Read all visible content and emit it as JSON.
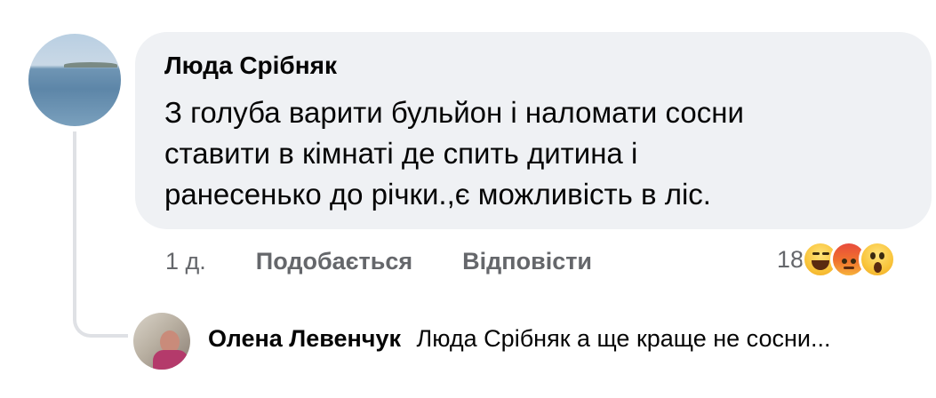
{
  "comment": {
    "author": "Люда Срібняк",
    "text": "З голуба варити бульйон і  наломати сосни\nставити в кімнаті де спить дитина і\nранесенько до річки.,є можливість в ліс.",
    "time": "1 д.",
    "like_label": "Подобається",
    "reply_label": "Відповісти",
    "reactions": {
      "count": "18",
      "icons": [
        "laughing-reaction-icon",
        "angry-reaction-icon",
        "wow-reaction-icon"
      ]
    }
  },
  "reply": {
    "author": "Олена Левенчук",
    "preview": "Люда Срібняк а ще краще не сосни..."
  },
  "colors": {
    "bubble": "#eff1f4",
    "secondary_text": "#65676b",
    "primary_text": "#050505",
    "thread_line": "#dfe1e5"
  }
}
